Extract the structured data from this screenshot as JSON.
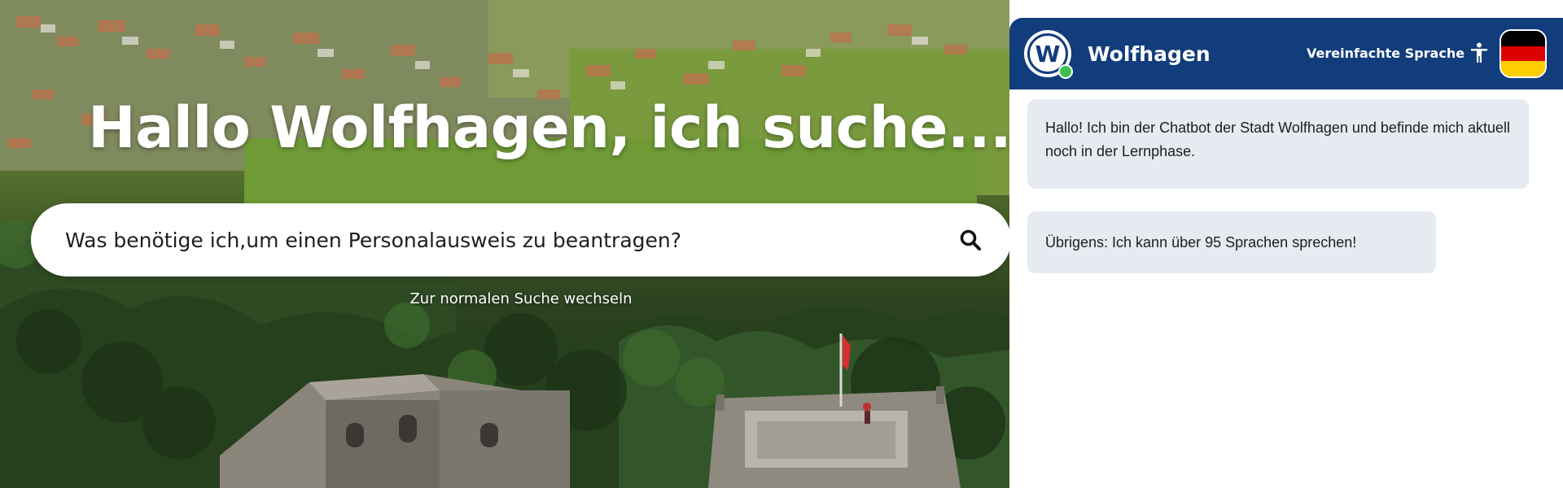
{
  "hero": {
    "title": "Hallo Wolfhagen, ich suche...",
    "search_value": "Was benötige ich,um einen Personalausweis zu beantragen?",
    "search_icon": "search-icon",
    "switch_link": "Zur normalen Suche wechseln"
  },
  "chat": {
    "header": {
      "logo_letter": "W",
      "bot_name": "Wolfhagen",
      "easy_language_label": "Vereinfachte Sprache",
      "easy_language_icon": "accessibility-person-icon",
      "language_flag": "germany-flag-icon"
    },
    "messages": [
      {
        "text": "Hallo! Ich bin der Chatbot der Stadt Wolfhagen und befinde mich aktuell noch in der Lernphase."
      },
      {
        "text": "Übrigens: Ich kann über 95 Sprachen sprechen!"
      }
    ]
  },
  "colors": {
    "header_blue": "#123d7c",
    "bubble_bg": "#e6eaf1",
    "online_green": "#3fbf4f",
    "flag_black": "#000000",
    "flag_red": "#dd0000",
    "flag_gold": "#ffce00"
  }
}
